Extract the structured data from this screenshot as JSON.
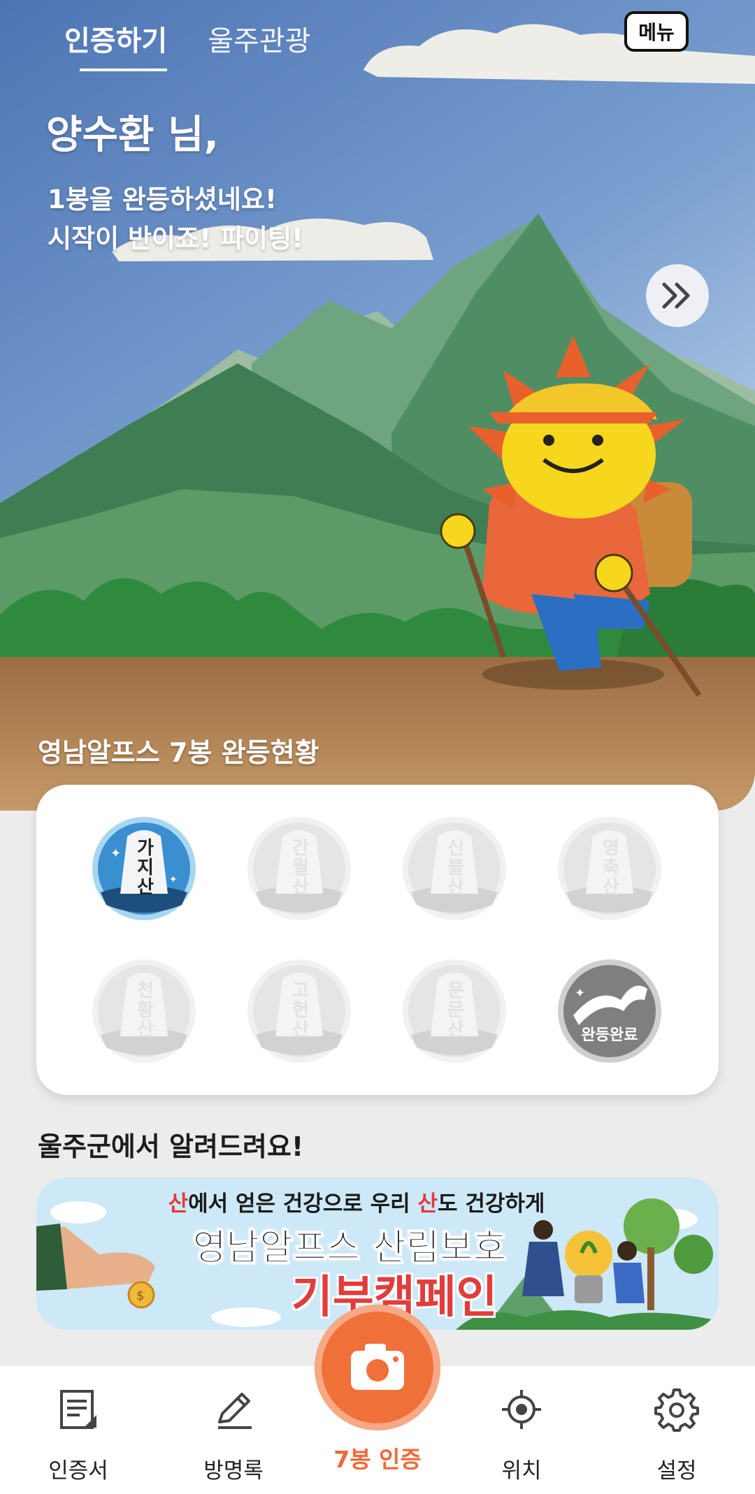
{
  "header": {
    "tabs": [
      {
        "label": "인증하기",
        "active": true
      },
      {
        "label": "울주관광",
        "active": false
      }
    ],
    "menu_label": "메뉴"
  },
  "greeting": {
    "name_line": "양수환 님,",
    "message_line1": "1봉을 완등하셨네요!",
    "message_line2": "시작이 반이죠! 파이팅!"
  },
  "progress": {
    "section_title": "영남알프스 7봉 완등현황",
    "completed_count": 1,
    "peaks": [
      {
        "name": "가지산",
        "completed": true
      },
      {
        "name": "간월산",
        "completed": false
      },
      {
        "name": "신불산",
        "completed": false
      },
      {
        "name": "영축산",
        "completed": false
      },
      {
        "name": "천황산",
        "completed": false
      },
      {
        "name": "고헌산",
        "completed": false
      },
      {
        "name": "운문산",
        "completed": false
      }
    ],
    "final_badge_label": "완등완료"
  },
  "notice": {
    "section_title": "울주군에서 알려드려요!",
    "banner": {
      "line1_part1": "산",
      "line1_part2": "에서 얻은 건강으로 우리 ",
      "line1_part3": "산",
      "line1_part4": "도 건강하게",
      "line2": "영남알프스 산림보호",
      "line3": "기부캠페인"
    }
  },
  "bottom_nav": {
    "items": [
      {
        "label": "인증서",
        "icon": "certificate-icon"
      },
      {
        "label": "방명록",
        "icon": "pencil-icon"
      },
      {
        "label": "7봉 인증",
        "icon": "camera-icon"
      },
      {
        "label": "위치",
        "icon": "location-target-icon"
      },
      {
        "label": "설정",
        "icon": "gear-icon"
      }
    ]
  },
  "colors": {
    "accent": "#ef6a3a",
    "sky": "#5a80bd",
    "ground": "#b08658",
    "badge_active": "#3c8fcf"
  }
}
